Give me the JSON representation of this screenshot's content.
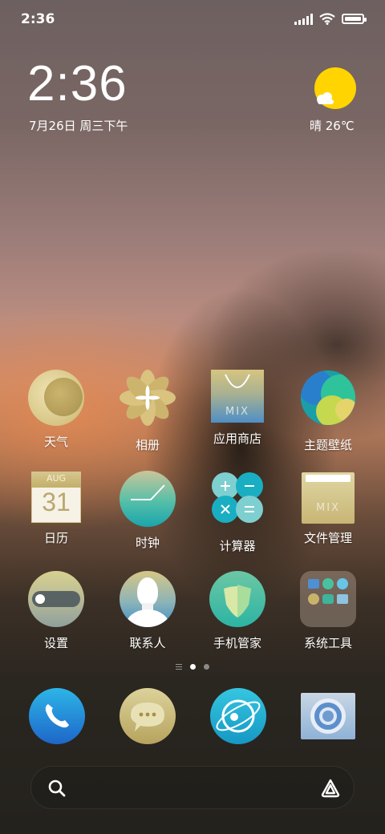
{
  "status_bar": {
    "time": "2:36"
  },
  "clock_widget": {
    "time": "2:36",
    "date": "7月26日 周三下午"
  },
  "weather_widget": {
    "text": "晴 26℃",
    "icon": "sunny-cloud-icon"
  },
  "apps": [
    {
      "label": "天气",
      "icon": "weather-moon-icon"
    },
    {
      "label": "相册",
      "icon": "gallery-flower-icon"
    },
    {
      "label": "应用商店",
      "icon": "app-store-bag-icon"
    },
    {
      "label": "主题壁纸",
      "icon": "themes-circles-icon"
    },
    {
      "label": "日历",
      "icon": "calendar-icon",
      "calendar_month": "AUG",
      "calendar_day": "31"
    },
    {
      "label": "时钟",
      "icon": "clock-icon"
    },
    {
      "label": "计算器",
      "icon": "calculator-icon"
    },
    {
      "label": "文件管理",
      "icon": "file-manager-icon"
    },
    {
      "label": "设置",
      "icon": "settings-toggle-icon"
    },
    {
      "label": "联系人",
      "icon": "contacts-person-icon"
    },
    {
      "label": "手机管家",
      "icon": "security-shield-icon"
    },
    {
      "label": "系统工具",
      "icon": "system-tools-folder-icon"
    }
  ],
  "app_store_brand": "MIX",
  "file_manager_brand": "MIX",
  "dock": [
    {
      "icon": "phone-icon"
    },
    {
      "icon": "messages-icon"
    },
    {
      "icon": "browser-icon"
    },
    {
      "icon": "camera-icon"
    }
  ],
  "page_indicator": {
    "pages": 2,
    "current": 1
  },
  "colors": {
    "weather_sun": "#ffd400",
    "accent_teal": "#2ab7b8",
    "accent_gold": "#c8b677"
  }
}
